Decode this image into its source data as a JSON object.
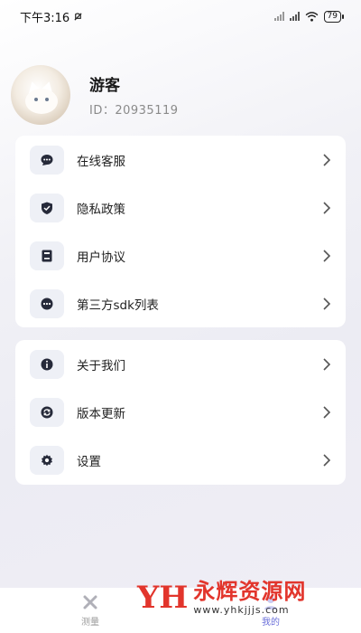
{
  "status_bar": {
    "time": "下午3:16",
    "battery": "79"
  },
  "profile": {
    "name": "游客",
    "id_label": "ID：20935119"
  },
  "menu_group_1": [
    {
      "label": "在线客服",
      "icon": "chat-icon"
    },
    {
      "label": "隐私政策",
      "icon": "shield-icon"
    },
    {
      "label": "用户协议",
      "icon": "document-icon"
    },
    {
      "label": "第三方sdk列表",
      "icon": "more-icon"
    }
  ],
  "menu_group_2": [
    {
      "label": "关于我们",
      "icon": "info-icon"
    },
    {
      "label": "版本更新",
      "icon": "refresh-icon"
    },
    {
      "label": "设置",
      "icon": "gear-icon"
    }
  ],
  "tabbar": [
    {
      "label": "测量",
      "icon": "measure-icon"
    },
    {
      "label": "我的",
      "icon": "profile-icon"
    }
  ],
  "watermark": {
    "logo": "YH",
    "title": "永辉资源网",
    "url": "www.yhkjjjs.com"
  },
  "colors": {
    "icon_dark": "#262a3a",
    "icon_bg": "#eef0f6",
    "watermark_red": "#e2352c"
  }
}
